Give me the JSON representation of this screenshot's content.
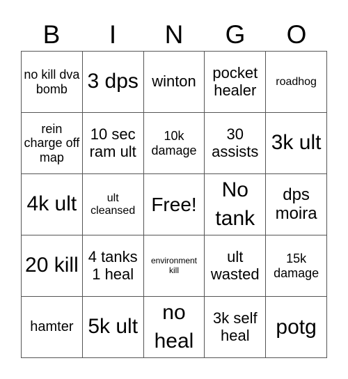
{
  "header": {
    "letters": [
      "B",
      "I",
      "N",
      "G",
      "O"
    ]
  },
  "cells": [
    [
      "no kill dva bomb",
      "3 dps",
      "winton",
      "pocket healer",
      "roadhog"
    ],
    [
      "rein charge off map",
      "10 sec ram ult",
      "10k damage",
      "30 assists",
      "3k ult"
    ],
    [
      "4k ult",
      "ult cleansed",
      "Free!",
      "No tank",
      "dps moira"
    ],
    [
      "20 kill",
      "4 tanks 1 heal",
      "environment kill",
      "ult wasted",
      "15k damage"
    ],
    [
      "hamter",
      "5k ult",
      "no heal",
      "3k self heal",
      "potg"
    ]
  ]
}
